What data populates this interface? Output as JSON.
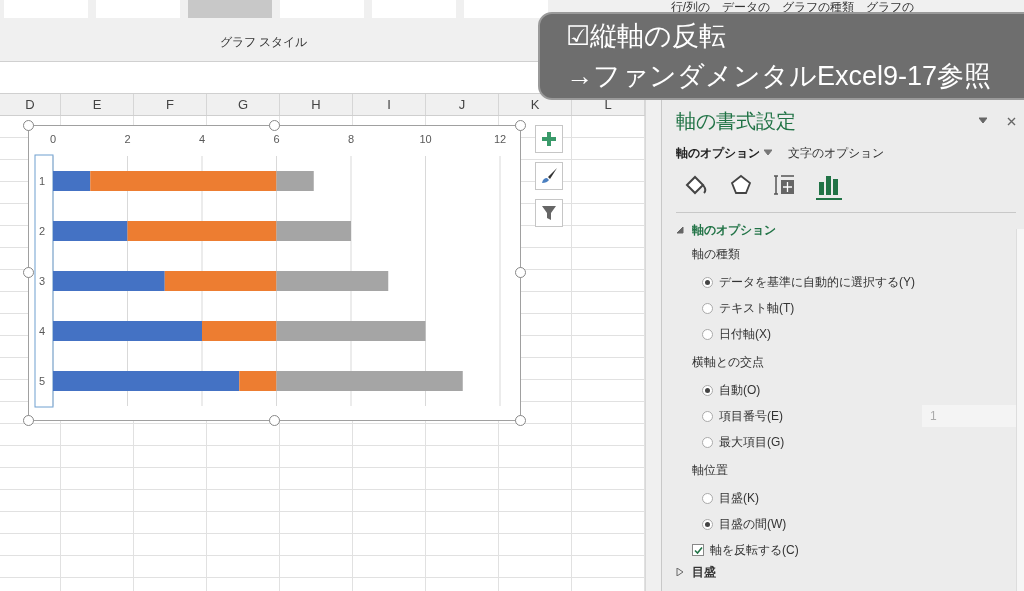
{
  "ribbon": {
    "style_thumbnails": [
      {
        "selected": false
      },
      {
        "selected": false
      },
      {
        "selected": true
      },
      {
        "selected": false
      },
      {
        "selected": false
      },
      {
        "selected": false
      }
    ],
    "group_label": "グラフ スタイル",
    "buttons": [
      "行/列の",
      "データの",
      "グラフの種類",
      "グラフの"
    ]
  },
  "caption": {
    "lines": [
      "☑縦軸の反転",
      "→ファンダメンタルExcel9-17参照"
    ]
  },
  "sheet": {
    "columns": [
      "D",
      "E",
      "F",
      "G",
      "H",
      "I",
      "J",
      "K",
      "L"
    ]
  },
  "chart": {
    "side_buttons": [
      {
        "kind": "plus"
      },
      {
        "kind": "brush"
      },
      {
        "kind": "filter"
      }
    ],
    "chart_data": {
      "type": "bar",
      "orientation": "horizontal",
      "stacked": true,
      "categories": [
        "1",
        "2",
        "3",
        "4",
        "5"
      ],
      "series": [
        {
          "color": "#4472c4",
          "values": [
            1,
            2,
            3,
            4,
            5
          ]
        },
        {
          "color": "#ed7d31",
          "values": [
            5,
            4,
            3,
            2,
            1
          ]
        },
        {
          "color": "#a5a5a5",
          "values": [
            1,
            2,
            3,
            4,
            5
          ]
        }
      ],
      "grid": true,
      "xlim": [
        0,
        12
      ],
      "xticks": [
        0,
        2,
        4,
        6,
        8,
        10,
        12
      ]
    }
  },
  "pane": {
    "title": "軸の書式設定",
    "tabs": [
      {
        "label": "軸のオプション",
        "selected": true
      },
      {
        "label": "文字のオプション",
        "selected": false
      }
    ],
    "icon_tabs": [
      {
        "kind": "fill",
        "selected": false
      },
      {
        "kind": "effects",
        "selected": false
      },
      {
        "kind": "size",
        "selected": false
      },
      {
        "kind": "options",
        "selected": true
      }
    ],
    "sections": [
      {
        "title": "軸のオプション",
        "expanded": true,
        "groups": [
          {
            "label": "軸の種類",
            "options": [
              {
                "label": "データを基準に自動的に選択する(Y)",
                "selected": true
              },
              {
                "label": "テキスト軸(T)",
                "selected": false
              },
              {
                "label": "日付軸(X)",
                "selected": false
              }
            ]
          },
          {
            "label": "横軸との交点",
            "options": [
              {
                "label": "自動(O)",
                "selected": true
              },
              {
                "label": "項目番号(E)",
                "selected": false,
                "field": "1"
              },
              {
                "label": "最大項目(G)",
                "selected": false
              }
            ]
          },
          {
            "label": "軸位置",
            "options": [
              {
                "label": "目盛(K)",
                "selected": false
              },
              {
                "label": "目盛の間(W)",
                "selected": true
              }
            ]
          }
        ],
        "checkbox": {
          "label": "軸を反転する(C)",
          "checked": true
        }
      },
      {
        "title": "目盛",
        "expanded": false
      }
    ]
  }
}
